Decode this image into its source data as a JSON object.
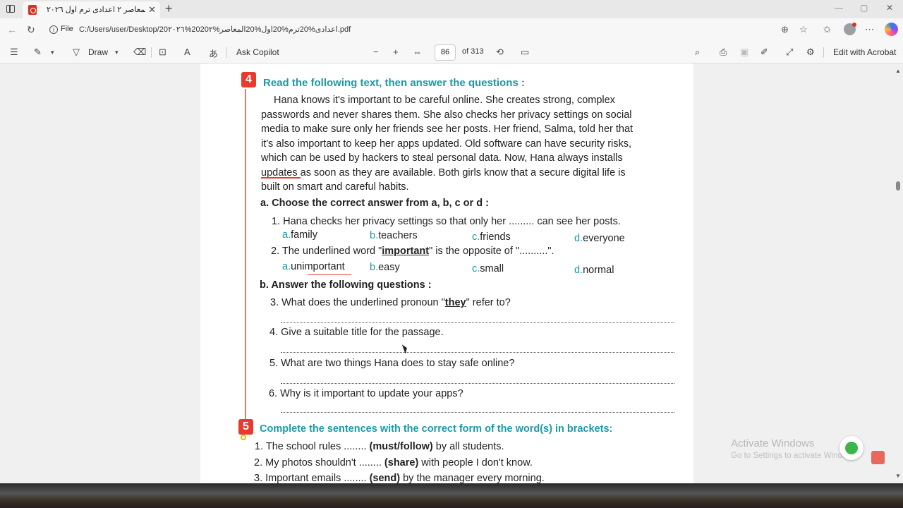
{
  "browser": {
    "tab_title": "المعاصر ٢ اعدادى ترم اول ٢٠٢٦.pdf",
    "url_scheme": "File",
    "url": "C:/Users/user/Desktop/20٢٠٢٦%20اعدادى%20ترم%20اول%20المعاصر%20٢.pdf",
    "new_tab_symbol": "+"
  },
  "toolbar": {
    "draw_label": "Draw",
    "copilot_label": "Ask Copilot",
    "page_current": "86",
    "page_total": "of 313",
    "edit_label": "Edit with Acrobat"
  },
  "document": {
    "q4_number": "4",
    "q4_heading": "Read the following text, then answer the questions :",
    "passage_lines": [
      "Hana knows it's important to be careful online. She creates strong, complex",
      "passwords and never shares them. She also checks her privacy settings on social",
      "media to make sure only her friends see her posts. Her friend, Salma, told her that",
      "it's also important to keep her apps updated. Old software can have security risks,",
      "which can be used by hackers to steal personal data. Now, Hana always installs",
      "updates as soon as they are available. Both girls know that a secure digital life is",
      "built on smart and careful habits."
    ],
    "part_a_heading": "a. Choose the correct answer from a, b, c or d :",
    "q1_text": "1. Hana checks her privacy settings so that only her ......... can see her posts.",
    "q1_options": [
      {
        "letter": "a.",
        "text": "family"
      },
      {
        "letter": "b.",
        "text": "teachers"
      },
      {
        "letter": "c.",
        "text": "friends"
      },
      {
        "letter": "d.",
        "text": "everyone"
      }
    ],
    "q2_prefix": "2. The underlined word \"",
    "q2_word": "important",
    "q2_suffix": "\" is the opposite of \"..........\".",
    "q2_options": [
      {
        "letter": "a.",
        "text": "unimportant"
      },
      {
        "letter": "b.",
        "text": "easy"
      },
      {
        "letter": "c.",
        "text": "small"
      },
      {
        "letter": "d.",
        "text": "normal"
      }
    ],
    "part_b_heading": "b. Answer the following questions :",
    "q3_prefix": "3. What does the underlined pronoun \"",
    "q3_word": "they",
    "q3_suffix": "\" refer to?",
    "q4_text": "4. Give a suitable title for the passage.",
    "q5_text": "5. What are two things Hana does to stay safe online?",
    "q6_text": "6. Why is it important to update your apps?",
    "q5_number": "5",
    "q5_heading": "Complete the sentences with the correct form of the word(s) in brackets:",
    "s1_prefix": "1. The school rules ........ ",
    "s1_word": "(must/follow)",
    "s1_suffix": " by all students.",
    "s2_prefix": "2. My photos shouldn't ........ ",
    "s2_word": "(share)",
    "s2_suffix": " with people I don't know.",
    "s3_prefix": "3. Important emails ........ ",
    "s3_word": "(send)",
    "s3_suffix": " by the manager every morning."
  },
  "overlay": {
    "activate_title": "Activate Windows",
    "activate_sub": "Go to Settings to activate Windows."
  }
}
